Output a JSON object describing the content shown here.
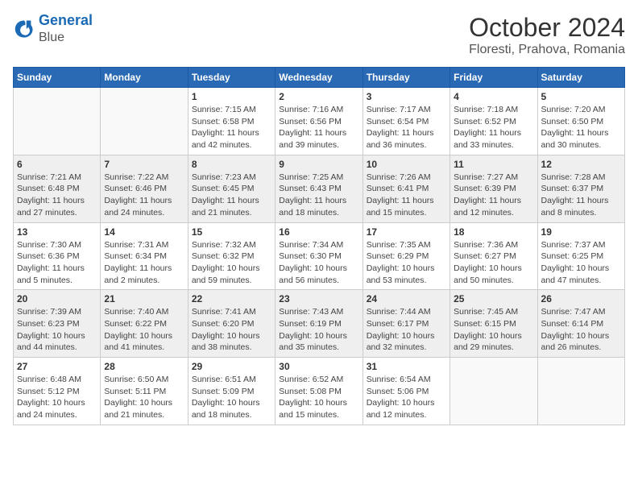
{
  "header": {
    "logo_line1": "General",
    "logo_line2": "Blue",
    "month": "October 2024",
    "location": "Floresti, Prahova, Romania"
  },
  "weekdays": [
    "Sunday",
    "Monday",
    "Tuesday",
    "Wednesday",
    "Thursday",
    "Friday",
    "Saturday"
  ],
  "weeks": [
    [
      {
        "day": "",
        "info": ""
      },
      {
        "day": "",
        "info": ""
      },
      {
        "day": "1",
        "info": "Sunrise: 7:15 AM\nSunset: 6:58 PM\nDaylight: 11 hours and 42 minutes."
      },
      {
        "day": "2",
        "info": "Sunrise: 7:16 AM\nSunset: 6:56 PM\nDaylight: 11 hours and 39 minutes."
      },
      {
        "day": "3",
        "info": "Sunrise: 7:17 AM\nSunset: 6:54 PM\nDaylight: 11 hours and 36 minutes."
      },
      {
        "day": "4",
        "info": "Sunrise: 7:18 AM\nSunset: 6:52 PM\nDaylight: 11 hours and 33 minutes."
      },
      {
        "day": "5",
        "info": "Sunrise: 7:20 AM\nSunset: 6:50 PM\nDaylight: 11 hours and 30 minutes."
      }
    ],
    [
      {
        "day": "6",
        "info": "Sunrise: 7:21 AM\nSunset: 6:48 PM\nDaylight: 11 hours and 27 minutes."
      },
      {
        "day": "7",
        "info": "Sunrise: 7:22 AM\nSunset: 6:46 PM\nDaylight: 11 hours and 24 minutes."
      },
      {
        "day": "8",
        "info": "Sunrise: 7:23 AM\nSunset: 6:45 PM\nDaylight: 11 hours and 21 minutes."
      },
      {
        "day": "9",
        "info": "Sunrise: 7:25 AM\nSunset: 6:43 PM\nDaylight: 11 hours and 18 minutes."
      },
      {
        "day": "10",
        "info": "Sunrise: 7:26 AM\nSunset: 6:41 PM\nDaylight: 11 hours and 15 minutes."
      },
      {
        "day": "11",
        "info": "Sunrise: 7:27 AM\nSunset: 6:39 PM\nDaylight: 11 hours and 12 minutes."
      },
      {
        "day": "12",
        "info": "Sunrise: 7:28 AM\nSunset: 6:37 PM\nDaylight: 11 hours and 8 minutes."
      }
    ],
    [
      {
        "day": "13",
        "info": "Sunrise: 7:30 AM\nSunset: 6:36 PM\nDaylight: 11 hours and 5 minutes."
      },
      {
        "day": "14",
        "info": "Sunrise: 7:31 AM\nSunset: 6:34 PM\nDaylight: 11 hours and 2 minutes."
      },
      {
        "day": "15",
        "info": "Sunrise: 7:32 AM\nSunset: 6:32 PM\nDaylight: 10 hours and 59 minutes."
      },
      {
        "day": "16",
        "info": "Sunrise: 7:34 AM\nSunset: 6:30 PM\nDaylight: 10 hours and 56 minutes."
      },
      {
        "day": "17",
        "info": "Sunrise: 7:35 AM\nSunset: 6:29 PM\nDaylight: 10 hours and 53 minutes."
      },
      {
        "day": "18",
        "info": "Sunrise: 7:36 AM\nSunset: 6:27 PM\nDaylight: 10 hours and 50 minutes."
      },
      {
        "day": "19",
        "info": "Sunrise: 7:37 AM\nSunset: 6:25 PM\nDaylight: 10 hours and 47 minutes."
      }
    ],
    [
      {
        "day": "20",
        "info": "Sunrise: 7:39 AM\nSunset: 6:23 PM\nDaylight: 10 hours and 44 minutes."
      },
      {
        "day": "21",
        "info": "Sunrise: 7:40 AM\nSunset: 6:22 PM\nDaylight: 10 hours and 41 minutes."
      },
      {
        "day": "22",
        "info": "Sunrise: 7:41 AM\nSunset: 6:20 PM\nDaylight: 10 hours and 38 minutes."
      },
      {
        "day": "23",
        "info": "Sunrise: 7:43 AM\nSunset: 6:19 PM\nDaylight: 10 hours and 35 minutes."
      },
      {
        "day": "24",
        "info": "Sunrise: 7:44 AM\nSunset: 6:17 PM\nDaylight: 10 hours and 32 minutes."
      },
      {
        "day": "25",
        "info": "Sunrise: 7:45 AM\nSunset: 6:15 PM\nDaylight: 10 hours and 29 minutes."
      },
      {
        "day": "26",
        "info": "Sunrise: 7:47 AM\nSunset: 6:14 PM\nDaylight: 10 hours and 26 minutes."
      }
    ],
    [
      {
        "day": "27",
        "info": "Sunrise: 6:48 AM\nSunset: 5:12 PM\nDaylight: 10 hours and 24 minutes."
      },
      {
        "day": "28",
        "info": "Sunrise: 6:50 AM\nSunset: 5:11 PM\nDaylight: 10 hours and 21 minutes."
      },
      {
        "day": "29",
        "info": "Sunrise: 6:51 AM\nSunset: 5:09 PM\nDaylight: 10 hours and 18 minutes."
      },
      {
        "day": "30",
        "info": "Sunrise: 6:52 AM\nSunset: 5:08 PM\nDaylight: 10 hours and 15 minutes."
      },
      {
        "day": "31",
        "info": "Sunrise: 6:54 AM\nSunset: 5:06 PM\nDaylight: 10 hours and 12 minutes."
      },
      {
        "day": "",
        "info": ""
      },
      {
        "day": "",
        "info": ""
      }
    ]
  ]
}
